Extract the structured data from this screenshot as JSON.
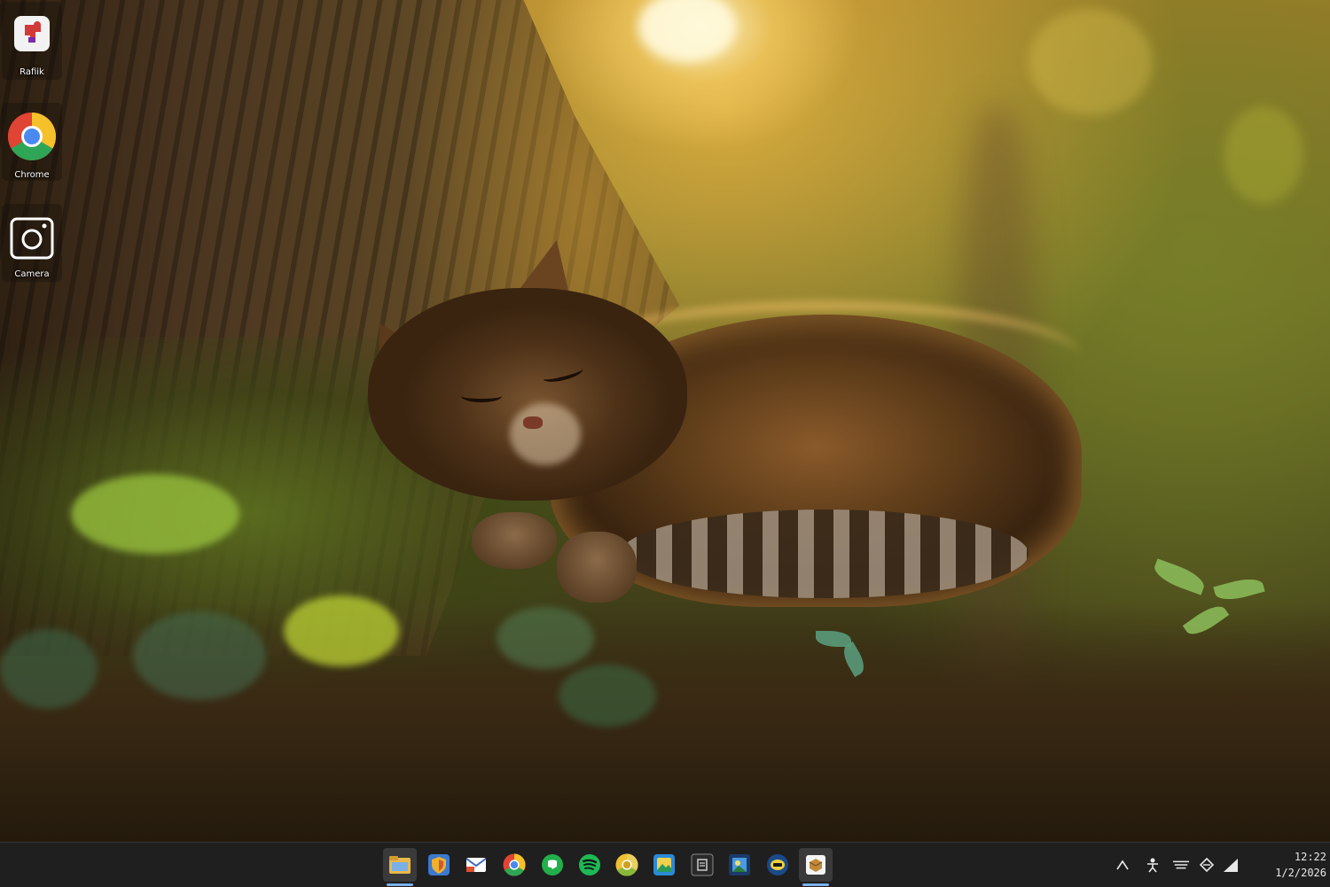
{
  "desktop": {
    "icons": [
      {
        "label": "Rafiik",
        "icon": "red-puzzle-app-icon"
      },
      {
        "label": "Chrome",
        "icon": "chrome-icon"
      },
      {
        "label": "Camera",
        "icon": "camera-icon"
      }
    ]
  },
  "wallpaper": {
    "subject": "sleeping-tabby-kitten-under-tree"
  },
  "taskbar": {
    "apps": [
      {
        "icon": "file-explorer-icon",
        "active": true
      },
      {
        "icon": "security-shield-icon",
        "active": false
      },
      {
        "icon": "mail-app-icon",
        "active": false
      },
      {
        "icon": "chrome-icon",
        "active": false
      },
      {
        "icon": "green-chat-icon",
        "active": false
      },
      {
        "icon": "spotify-icon",
        "active": false
      },
      {
        "icon": "chrome-canary-icon",
        "active": false
      },
      {
        "icon": "photos-icon",
        "active": false
      },
      {
        "icon": "dark-app-icon",
        "active": false
      },
      {
        "icon": "image-viewer-icon",
        "active": false
      },
      {
        "icon": "messenger-icon",
        "active": false
      },
      {
        "icon": "package-icon",
        "active": true
      }
    ],
    "tray": [
      {
        "icon": "chevron-up-icon"
      },
      {
        "icon": "user-accessibility-icon"
      },
      {
        "icon": "keyboard-icon"
      },
      {
        "icon": "network-icon"
      },
      {
        "icon": "signal-icon"
      }
    ],
    "clock": {
      "time": "12:22",
      "date": "1/2/2026"
    }
  },
  "colors": {
    "taskbar_bg": "#1f1f1f",
    "accent": "#7ab0e8"
  }
}
